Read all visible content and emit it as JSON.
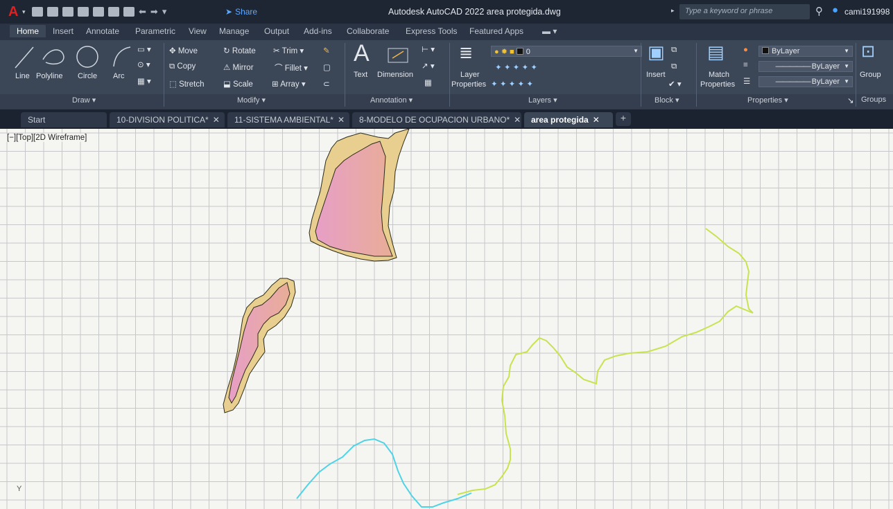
{
  "titlebar": {
    "logo": "A",
    "share_label": "Share",
    "title": "Autodesk AutoCAD 2022   area protegida.dwg",
    "search_placeholder": "Type a keyword or phrase",
    "user_name": "cami191998"
  },
  "ribbon_tabs": [
    "Home",
    "Insert",
    "Annotate",
    "Parametric",
    "View",
    "Manage",
    "Output",
    "Add-ins",
    "Collaborate",
    "Express Tools",
    "Featured Apps"
  ],
  "draw": {
    "tools": [
      "Line",
      "Polyline",
      "Circle",
      "Arc"
    ],
    "panel_title": "Draw ▾"
  },
  "modify": {
    "row1": [
      "Move",
      "Rotate",
      "Trim ▾"
    ],
    "row2": [
      "Copy",
      "Mirror",
      "Fillet ▾"
    ],
    "row3": [
      "Stretch",
      "Scale",
      "Array ▾"
    ],
    "panel_title": "Modify ▾"
  },
  "annotation": {
    "text": "Text",
    "dimension": "Dimension",
    "panel_title": "Annotation ▾"
  },
  "layers": {
    "properties_line1": "Layer",
    "properties_line2": "Properties",
    "current_layer": "0",
    "panel_title": "Layers ▾"
  },
  "block": {
    "insert": "Insert",
    "panel_title": "Block ▾"
  },
  "properties": {
    "match_line1": "Match",
    "match_line2": "Properties",
    "color": "ByLayer",
    "linetype": "ByLayer",
    "lineweight": "ByLayer",
    "panel_title": "Properties ▾"
  },
  "groups": {
    "group": "Group",
    "panel_title": "Groups"
  },
  "doc_tabs": [
    {
      "label": "Start",
      "closable": false,
      "active": false
    },
    {
      "label": "10-DIVISION POLITICA*",
      "closable": true,
      "active": false
    },
    {
      "label": "11-SISTEMA AMBIENTAL*",
      "closable": true,
      "active": false
    },
    {
      "label": "8-MODELO DE OCUPACION URBANO*",
      "closable": true,
      "active": false
    },
    {
      "label": "area protegida",
      "closable": true,
      "active": true
    }
  ],
  "viewport": {
    "label": "[−][Top][2D Wireframe]",
    "ucs_label": "Y"
  },
  "colors": {
    "polygon_outline": "#e9cf8f",
    "polygon_fill_a": "#e79fc6",
    "polygon_fill_b": "#e8ad97",
    "line_green": "#c7e34e",
    "line_cyan": "#4fd3e6",
    "grid": "#c5c7c8"
  }
}
